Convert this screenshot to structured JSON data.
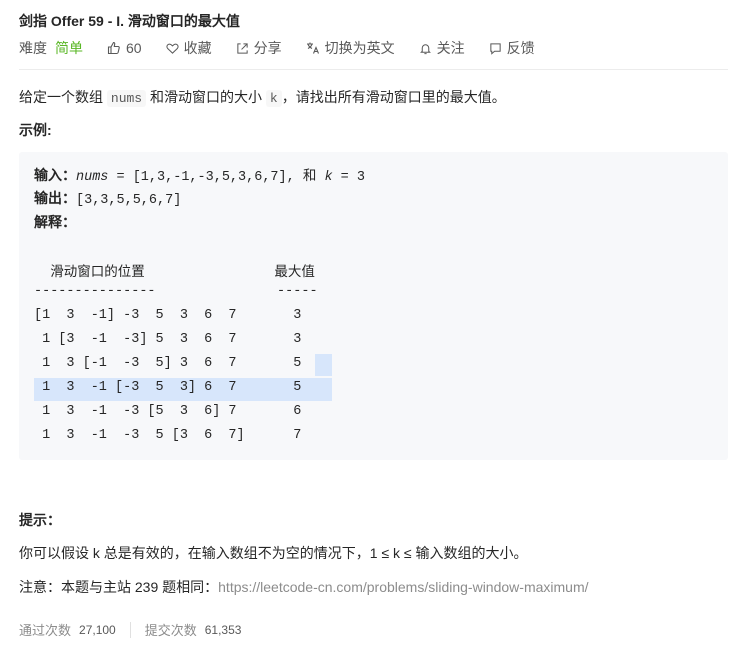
{
  "problem": {
    "title": "剑指 Offer 59 - I. 滑动窗口的最大值",
    "difficulty_label": "难度",
    "difficulty": "简单",
    "likes": "60",
    "favorite": "收藏",
    "share": "分享",
    "switch_lang": "切换为英文",
    "follow": "关注",
    "feedback": "反馈"
  },
  "description": {
    "part1": "给定一个数组 ",
    "code1": "nums",
    "part2": " 和滑动窗口的大小 ",
    "code2": "k",
    "part3": "，请找出所有滑动窗口里的最大值。"
  },
  "example": {
    "label": "示例:",
    "input_label": "输入：",
    "input_var1": "nums",
    "input_mid": " = [1,3,-1,-3,5,3,6,7], 和 ",
    "input_var2": "k",
    "input_end": " = 3",
    "output_label": "输出：",
    "output_value": "[3,3,5,5,6,7]",
    "explain_label": "解释：",
    "table_header": "  滑动窗口的位置                最大值",
    "table_sep": "---------------               -----",
    "rows": [
      "[1  3  -1] -3  5  3  6  7       3",
      " 1 [3  -1  -3] 5  3  6  7       3",
      " 1  3 [-1  -3  5] 3  6  7       5",
      " 1  3  -1 [-3  5  3] 6  7       5",
      " 1  3  -1  -3 [5  3  6] 7       6",
      " 1  3  -1  -3  5 [3  6  7]      7"
    ]
  },
  "hint": {
    "label": "提示：",
    "text": "你可以假设 k 总是有效的，在输入数组不为空的情况下，1 ≤ k ≤ 输入数组的大小。"
  },
  "note": {
    "prefix": "注意：本题与主站 239 题相同：",
    "link": "https://leetcode-cn.com/problems/sliding-window-maximum/"
  },
  "stats": {
    "accepted_label": "通过次数",
    "accepted": "27,100",
    "submitted_label": "提交次数",
    "submitted": "61,353"
  }
}
